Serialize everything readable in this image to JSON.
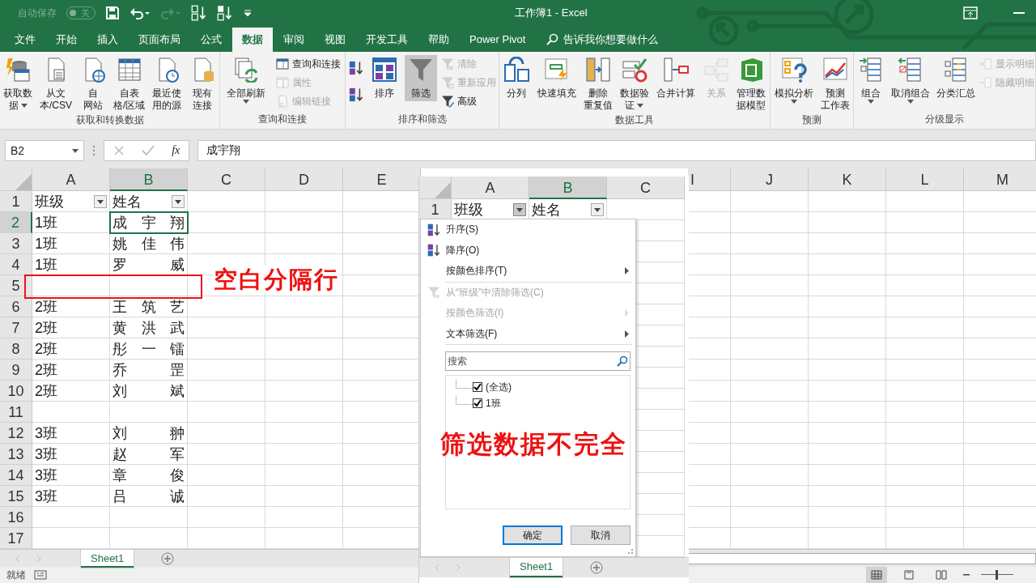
{
  "title_bar": {
    "autosave_label": "自动保存",
    "autosave_on": false,
    "autosave_state": "关",
    "title": "工作簿1  -  Excel"
  },
  "ribbon_tabs": [
    {
      "label": "文件",
      "selected": false
    },
    {
      "label": "开始",
      "selected": false
    },
    {
      "label": "插入",
      "selected": false
    },
    {
      "label": "页面布局",
      "selected": false
    },
    {
      "label": "公式",
      "selected": false
    },
    {
      "label": "数据",
      "selected": true
    },
    {
      "label": "审阅",
      "selected": false
    },
    {
      "label": "视图",
      "selected": false
    },
    {
      "label": "开发工具",
      "selected": false
    },
    {
      "label": "帮助",
      "selected": false
    },
    {
      "label": "Power Pivot",
      "selected": false
    }
  ],
  "tell_me": "告诉我你想要做什么",
  "ribbon_groups": [
    {
      "label": "获取和转换数据",
      "buttons": [
        {
          "kind": "large",
          "lines": [
            "获取数",
            "据"
          ],
          "menu": true,
          "disabled": false,
          "pressed": false
        },
        {
          "kind": "large",
          "lines": [
            "从文",
            "本/CSV"
          ],
          "menu": false,
          "disabled": false,
          "pressed": false
        },
        {
          "kind": "large",
          "lines": [
            "自",
            "网站"
          ],
          "menu": false,
          "disabled": false,
          "pressed": false
        },
        {
          "kind": "large",
          "lines": [
            "自表",
            "格/区域"
          ],
          "menu": false,
          "disabled": false,
          "pressed": false
        },
        {
          "kind": "large",
          "lines": [
            "最近使",
            "用的源"
          ],
          "menu": false,
          "disabled": false,
          "pressed": false
        },
        {
          "kind": "large",
          "lines": [
            "现有",
            "连接"
          ],
          "menu": false,
          "disabled": false,
          "pressed": false
        }
      ]
    },
    {
      "label": "查询和连接",
      "buttons": [
        {
          "kind": "large",
          "lines": [
            "全部刷新"
          ],
          "menu": true,
          "disabled": false,
          "pressed": false
        },
        {
          "kind": "small",
          "lines": [
            "查询和连接"
          ],
          "menu": false,
          "disabled": false,
          "pressed": false
        },
        {
          "kind": "small",
          "lines": [
            "属性"
          ],
          "menu": false,
          "disabled": true,
          "pressed": false
        },
        {
          "kind": "small",
          "lines": [
            "编辑链接"
          ],
          "menu": false,
          "disabled": true,
          "pressed": false
        }
      ]
    },
    {
      "label": "排序和筛选",
      "buttons": [
        {
          "kind": "icon",
          "menu": false,
          "disabled": false,
          "pressed": false
        },
        {
          "kind": "icon",
          "menu": false,
          "disabled": false,
          "pressed": false
        },
        {
          "kind": "large",
          "lines": [
            "排序"
          ],
          "menu": false,
          "disabled": false,
          "pressed": false
        },
        {
          "kind": "large",
          "lines": [
            "筛选"
          ],
          "menu": false,
          "disabled": false,
          "pressed": true
        },
        {
          "kind": "small",
          "lines": [
            "清除"
          ],
          "menu": false,
          "disabled": true,
          "pressed": false
        },
        {
          "kind": "small",
          "lines": [
            "重新应用"
          ],
          "menu": false,
          "disabled": true,
          "pressed": false
        },
        {
          "kind": "small",
          "lines": [
            "高级"
          ],
          "menu": false,
          "disabled": false,
          "pressed": false
        }
      ]
    },
    {
      "label": "数据工具",
      "buttons": [
        {
          "kind": "large",
          "lines": [
            "分列"
          ],
          "menu": false,
          "disabled": false,
          "pressed": false
        },
        {
          "kind": "large",
          "lines": [
            "快速填充"
          ],
          "menu": false,
          "disabled": false,
          "pressed": false
        },
        {
          "kind": "large",
          "lines": [
            "删除",
            "重复值"
          ],
          "menu": false,
          "disabled": false,
          "pressed": false
        },
        {
          "kind": "large",
          "lines": [
            "数据验",
            "证"
          ],
          "menu": true,
          "disabled": false,
          "pressed": false
        },
        {
          "kind": "large",
          "lines": [
            "合并计算"
          ],
          "menu": false,
          "disabled": false,
          "pressed": false
        },
        {
          "kind": "large",
          "lines": [
            "关系"
          ],
          "menu": false,
          "disabled": true,
          "pressed": false
        },
        {
          "kind": "large",
          "lines": [
            "管理数",
            "据模型"
          ],
          "menu": false,
          "disabled": false,
          "pressed": false
        }
      ]
    },
    {
      "label": "预测",
      "buttons": [
        {
          "kind": "large",
          "lines": [
            "模拟分析"
          ],
          "menu": true,
          "disabled": false,
          "pressed": false
        },
        {
          "kind": "large",
          "lines": [
            "预测",
            "工作表"
          ],
          "menu": false,
          "disabled": false,
          "pressed": false
        }
      ]
    },
    {
      "label": "分级显示",
      "buttons": [
        {
          "kind": "large",
          "lines": [
            "组合"
          ],
          "menu": true,
          "disabled": false,
          "pressed": false
        },
        {
          "kind": "large",
          "lines": [
            "取消组合"
          ],
          "menu": true,
          "disabled": false,
          "pressed": false
        },
        {
          "kind": "large",
          "lines": [
            "分类汇总"
          ],
          "menu": false,
          "disabled": false,
          "pressed": false
        },
        {
          "kind": "small",
          "lines": [
            "显示明细"
          ],
          "menu": false,
          "disabled": true,
          "pressed": false
        },
        {
          "kind": "small",
          "lines": [
            "隐藏明细"
          ],
          "menu": false,
          "disabled": true,
          "pressed": false
        }
      ]
    }
  ],
  "formula_bar": {
    "name_box": "B2",
    "function_label": "fx",
    "value": "成宇翔"
  },
  "sheet": {
    "columns": [
      {
        "label": "A",
        "selected": false
      },
      {
        "label": "B",
        "selected": true
      },
      {
        "label": "C",
        "selected": false
      },
      {
        "label": "D",
        "selected": false
      },
      {
        "label": "E",
        "selected": false
      },
      {
        "label": "I",
        "selected": false
      },
      {
        "label": "J",
        "selected": false
      },
      {
        "label": "K",
        "selected": false
      },
      {
        "label": "L",
        "selected": false
      },
      {
        "label": "M",
        "selected": false
      }
    ],
    "rows": [
      {
        "number": "1",
        "selected": false,
        "cells": [
          {
            "text": "班级",
            "selected": false,
            "filter_button": true
          },
          {
            "text": "姓名",
            "selected": false,
            "filter_button": true
          }
        ]
      },
      {
        "number": "2",
        "selected": true,
        "cells": [
          {
            "text": "1班",
            "selected": false,
            "filter_button": false
          },
          {
            "text": "成宇翔",
            "selected": true,
            "filter_button": false
          }
        ]
      },
      {
        "number": "3",
        "selected": false,
        "cells": [
          {
            "text": "1班",
            "selected": false,
            "filter_button": false
          },
          {
            "text": "姚佳伟",
            "selected": false,
            "filter_button": false
          }
        ]
      },
      {
        "number": "4",
        "selected": false,
        "cells": [
          {
            "text": "1班",
            "selected": false,
            "filter_button": false
          },
          {
            "text": "罗威",
            "selected": false,
            "filter_button": false
          }
        ]
      },
      {
        "number": "5",
        "selected": false,
        "cells": []
      },
      {
        "number": "6",
        "selected": false,
        "cells": [
          {
            "text": "2班",
            "selected": false,
            "filter_button": false
          },
          {
            "text": "王筑艺",
            "selected": false,
            "filter_button": false
          }
        ]
      },
      {
        "number": "7",
        "selected": false,
        "cells": [
          {
            "text": "2班",
            "selected": false,
            "filter_button": false
          },
          {
            "text": "黄洪武",
            "selected": false,
            "filter_button": false
          }
        ]
      },
      {
        "number": "8",
        "selected": false,
        "cells": [
          {
            "text": "2班",
            "selected": false,
            "filter_button": false
          },
          {
            "text": "彤一镭",
            "selected": false,
            "filter_button": false
          }
        ]
      },
      {
        "number": "9",
        "selected": false,
        "cells": [
          {
            "text": "2班",
            "selected": false,
            "filter_button": false
          },
          {
            "text": "乔罡",
            "selected": false,
            "filter_button": false
          }
        ]
      },
      {
        "number": "10",
        "selected": false,
        "cells": [
          {
            "text": "2班",
            "selected": false,
            "filter_button": false
          },
          {
            "text": "刘斌",
            "selected": false,
            "filter_button": false
          }
        ]
      },
      {
        "number": "11",
        "selected": false,
        "cells": []
      },
      {
        "number": "12",
        "selected": false,
        "cells": [
          {
            "text": "3班",
            "selected": false,
            "filter_button": false
          },
          {
            "text": "刘翀",
            "selected": false,
            "filter_button": false
          }
        ]
      },
      {
        "number": "13",
        "selected": false,
        "cells": [
          {
            "text": "3班",
            "selected": false,
            "filter_button": false
          },
          {
            "text": "赵军",
            "selected": false,
            "filter_button": false
          }
        ]
      },
      {
        "number": "14",
        "selected": false,
        "cells": [
          {
            "text": "3班",
            "selected": false,
            "filter_button": false
          },
          {
            "text": "章俊",
            "selected": false,
            "filter_button": false
          }
        ]
      },
      {
        "number": "15",
        "selected": false,
        "cells": [
          {
            "text": "3班",
            "selected": false,
            "filter_button": false
          },
          {
            "text": "吕诚",
            "selected": false,
            "filter_button": false
          }
        ]
      },
      {
        "number": "16",
        "selected": false,
        "cells": []
      },
      {
        "number": "17",
        "selected": false,
        "cells": []
      }
    ]
  },
  "sheet_tabs": [
    {
      "label": "Sheet1",
      "selected": true
    }
  ],
  "status_bar": {
    "text": "就绪",
    "zoom": {
      "level": 0.5
    }
  },
  "inset": {
    "columns": [
      {
        "label": "A",
        "selected": false
      },
      {
        "label": "B",
        "selected": true
      },
      {
        "label": "C",
        "selected": false
      }
    ],
    "rows": [
      {
        "number": "1",
        "cells": [
          {
            "text": "班级",
            "filter_open": true
          },
          {
            "text": "姓名",
            "filter_open": false
          }
        ]
      }
    ],
    "menu": {
      "items": [
        {
          "kind": "ascending",
          "label": "升序(S)",
          "disabled": false,
          "submenu": false
        },
        {
          "kind": "descending",
          "label": "降序(O)",
          "disabled": false,
          "submenu": false
        },
        {
          "kind": "plain",
          "label": "按颜色排序(T)",
          "disabled": false,
          "submenu": true
        },
        {
          "kind": "separator"
        },
        {
          "kind": "clearfilter",
          "label": "从“班级”中清除筛选(C)",
          "disabled": true,
          "submenu": false
        },
        {
          "kind": "plain",
          "label": "按颜色筛选(I)",
          "disabled": true,
          "submenu": true
        },
        {
          "kind": "plain",
          "label": "文本筛选(F)",
          "disabled": false,
          "submenu": true
        },
        {
          "kind": "separator"
        }
      ],
      "search_placeholder": "搜索",
      "checklist": [
        {
          "label": "(全选)",
          "checked": true
        },
        {
          "label": "1班",
          "checked": true
        }
      ],
      "buttons": [
        {
          "label": "确定",
          "focused": true
        },
        {
          "label": "取消",
          "focused": false
        }
      ]
    },
    "sheet_tabs": [
      {
        "label": "Sheet1",
        "selected": true
      }
    ]
  },
  "annotations": [
    {
      "kind": "boxed",
      "text": "空白分隔行"
    },
    {
      "kind": "plain",
      "text": "筛选数据不完全"
    }
  ]
}
